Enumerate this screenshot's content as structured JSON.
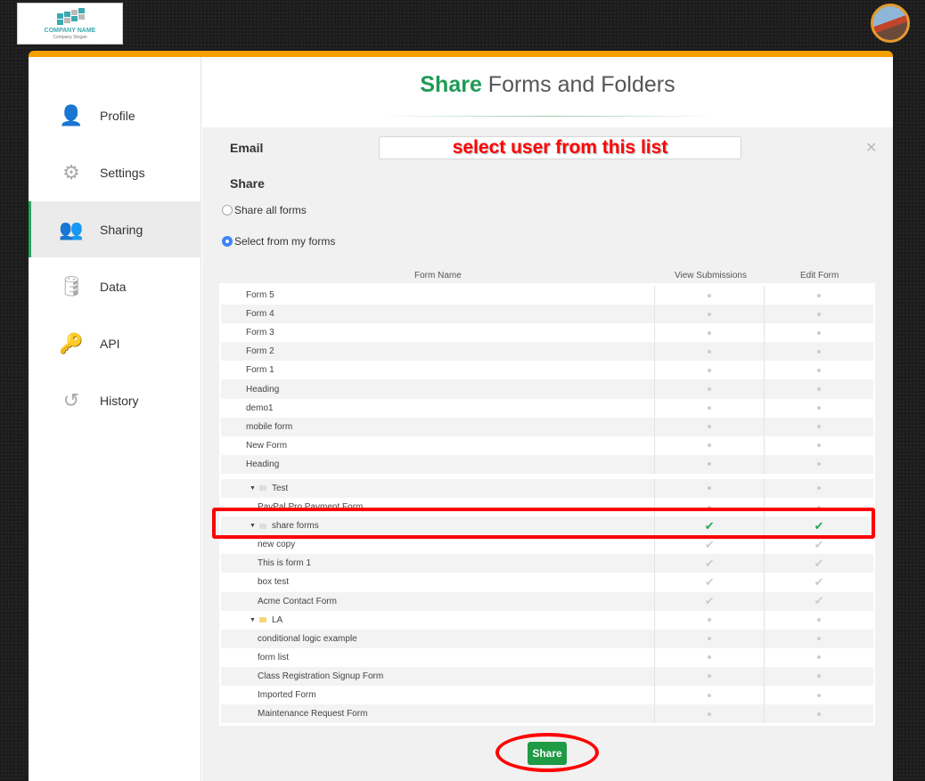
{
  "logo": {
    "name": "COMPANY NAME",
    "slogan": "Company Slogan"
  },
  "sidebar": {
    "items": [
      {
        "label": "Profile",
        "icon": "user-icon"
      },
      {
        "label": "Settings",
        "icon": "gear-icon"
      },
      {
        "label": "Sharing",
        "icon": "users-icon",
        "active": true
      },
      {
        "label": "Data",
        "icon": "database-icon"
      },
      {
        "label": "API",
        "icon": "keys-icon"
      },
      {
        "label": "History",
        "icon": "history-icon"
      }
    ]
  },
  "header": {
    "title_bold": "Share",
    "title_rest": " Forms and Folders"
  },
  "form": {
    "email_label": "Email",
    "email_annotation": "select user from this list",
    "share_label": "Share",
    "opt_all": "Share all forms",
    "opt_select": "Select from my forms",
    "selected": "Select from my forms"
  },
  "table": {
    "headers": [
      "Form Name",
      "View Submissions",
      "Edit Form"
    ],
    "rows": [
      {
        "name": "Form 5",
        "type": "form",
        "view": "none",
        "edit": "none"
      },
      {
        "name": "Form 4",
        "type": "form",
        "view": "none",
        "edit": "none"
      },
      {
        "name": "Form 3",
        "type": "form",
        "view": "none",
        "edit": "none"
      },
      {
        "name": "Form 2",
        "type": "form",
        "view": "none",
        "edit": "none"
      },
      {
        "name": "Form 1",
        "type": "form",
        "view": "none",
        "edit": "none"
      },
      {
        "name": "Heading",
        "type": "form",
        "view": "none",
        "edit": "none"
      },
      {
        "name": "demo1",
        "type": "form",
        "view": "none",
        "edit": "none"
      },
      {
        "name": "mobile form",
        "type": "form",
        "view": "none",
        "edit": "none"
      },
      {
        "name": "New Form",
        "type": "form",
        "view": "none",
        "edit": "none"
      },
      {
        "name": "Heading",
        "type": "form",
        "view": "none",
        "edit": "none"
      },
      {
        "name": "Test",
        "type": "folder",
        "view": "none",
        "edit": "none"
      },
      {
        "name": "PayPal Pro Payment Form",
        "type": "child",
        "view": "none",
        "edit": "none"
      },
      {
        "name": "share forms",
        "type": "folder",
        "view": "checked",
        "edit": "checked",
        "highlighted": true
      },
      {
        "name": "new copy",
        "type": "child",
        "view": "inherited",
        "edit": "inherited"
      },
      {
        "name": "This is form 1",
        "type": "child",
        "view": "inherited",
        "edit": "inherited"
      },
      {
        "name": "box test",
        "type": "child",
        "view": "inherited",
        "edit": "inherited"
      },
      {
        "name": "Acme Contact Form",
        "type": "child",
        "view": "inherited",
        "edit": "inherited"
      },
      {
        "name": "LA",
        "type": "folder",
        "color": "yellow",
        "view": "none",
        "edit": "none"
      },
      {
        "name": "conditional logic example",
        "type": "child",
        "view": "none",
        "edit": "none"
      },
      {
        "name": "form list",
        "type": "child",
        "view": "none",
        "edit": "none"
      },
      {
        "name": "Class Registration Signup Form",
        "type": "child",
        "view": "none",
        "edit": "none"
      },
      {
        "name": "Imported Form",
        "type": "child",
        "view": "none",
        "edit": "none"
      },
      {
        "name": "Maintenance Request Form",
        "type": "child",
        "view": "none",
        "edit": "none"
      }
    ]
  },
  "share_button": "Share",
  "colors": {
    "accent": "#1f9a55",
    "top_border": "#f5a000",
    "annotation": "#ff0000"
  }
}
